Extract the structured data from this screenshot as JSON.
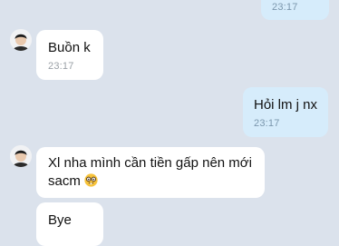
{
  "messages": [
    {
      "id": "m0",
      "direction": "outgoing",
      "text": "",
      "time": "23:17"
    },
    {
      "id": "m1",
      "direction": "incoming",
      "text": "Buồn k",
      "time": "23:17"
    },
    {
      "id": "m2",
      "direction": "outgoing",
      "text": "Hỏi lm j nx",
      "time": "23:17"
    },
    {
      "id": "m3",
      "direction": "incoming",
      "line1": "Xl nha mình cần tiền gấp nên mới",
      "line2": "sacm",
      "emoji": "nerd-face-emoji"
    },
    {
      "id": "m4",
      "direction": "incoming",
      "text": "Bye"
    }
  ],
  "colors": {
    "background": "#dbe2ec",
    "incoming_bubble": "#ffffff",
    "outgoing_bubble": "#d6ecfb",
    "incoming_time": "#9aa0a6",
    "outgoing_time": "#7b97ad"
  }
}
